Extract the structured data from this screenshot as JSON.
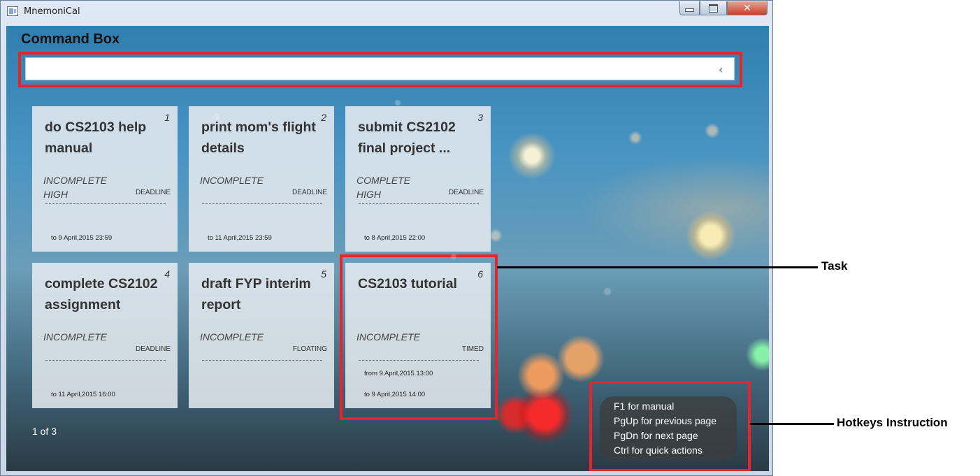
{
  "window": {
    "title": "MnemoniCal",
    "close_glyph": "✕"
  },
  "command_box": {
    "label": "Command Box",
    "value": "",
    "placeholder": "",
    "chevron": "‹"
  },
  "tasks": [
    {
      "number": "1",
      "title": "do CS2103 help manual",
      "status": "INCOMPLETE",
      "priority": "HIGH",
      "type": "DEADLINE",
      "from": "",
      "to": "to 9 April,2015 23:59"
    },
    {
      "number": "2",
      "title": "print mom's flight details",
      "status": "INCOMPLETE",
      "priority": "",
      "type": "DEADLINE",
      "from": "",
      "to": "to 11 April,2015 23:59"
    },
    {
      "number": "3",
      "title": "submit CS2102 final project ...",
      "status": "COMPLETE",
      "priority": "HIGH",
      "type": "DEADLINE",
      "from": "",
      "to": "to 8 April,2015 22:00"
    },
    {
      "number": "4",
      "title": "complete CS2102 assignment",
      "status": "INCOMPLETE",
      "priority": "",
      "type": "DEADLINE",
      "from": "",
      "to": "to 11 April,2015 16:00"
    },
    {
      "number": "5",
      "title": "draft FYP interim report",
      "status": "INCOMPLETE",
      "priority": "",
      "type": "FLOATING",
      "from": "",
      "to": ""
    },
    {
      "number": "6",
      "title": "CS2103 tutorial",
      "status": "INCOMPLETE",
      "priority": "",
      "type": "TIMED",
      "from": "from 9 April,2015 13:00",
      "to": "to 9 April,2015 14:00"
    }
  ],
  "pagination": {
    "text": "1 of 3"
  },
  "hotkeys": [
    "F1 for manual",
    "PgUp for previous page",
    "PgDn for next page",
    "Ctrl for quick actions"
  ],
  "annotations": {
    "task": "Task",
    "hotkeys": "Hotkeys Instruction"
  },
  "colors": {
    "highlight": "#e8232a",
    "card_bg": "#e7ebf0",
    "close_button": "#c7412a"
  }
}
